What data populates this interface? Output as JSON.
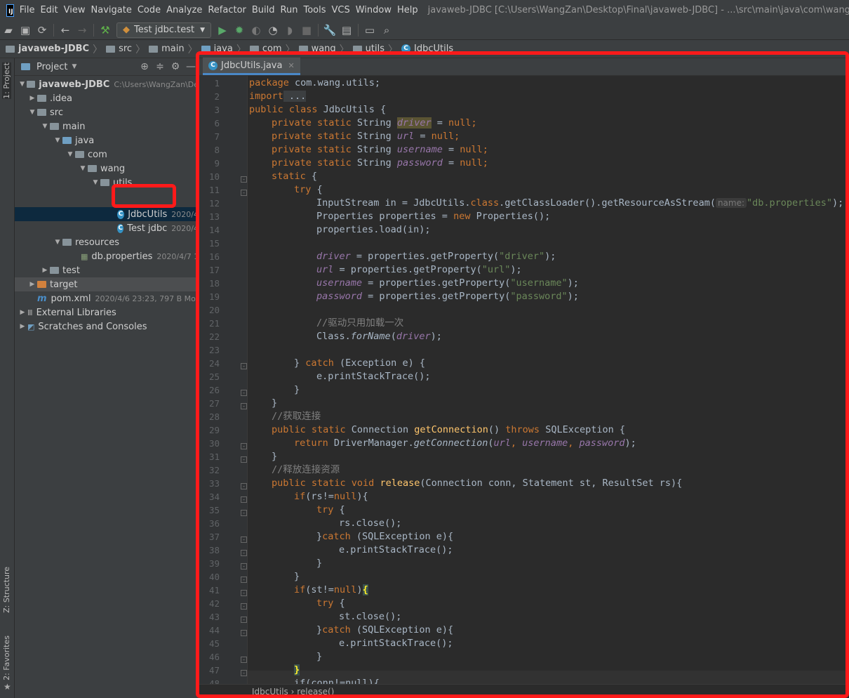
{
  "app": {
    "logo_text": "IJ",
    "window_title": "javaweb-JDBC [C:\\Users\\WangZan\\Desktop\\Final\\javaweb-JDBC] - ...\\src\\main\\java\\com\\wang\\utils\\"
  },
  "menu": [
    "File",
    "Edit",
    "View",
    "Navigate",
    "Code",
    "Analyze",
    "Refactor",
    "Build",
    "Run",
    "Tools",
    "VCS",
    "Window",
    "Help"
  ],
  "toolbar": {
    "run_config": "Test jdbc.test"
  },
  "breadcrumbs": [
    "javaweb-JDBC",
    "src",
    "main",
    "java",
    "com",
    "wang",
    "utils",
    "JdbcUtils"
  ],
  "side_tabs": {
    "project": "1: Project",
    "structure": "Z: Structure",
    "favorites": "2: Favorites"
  },
  "project_panel": {
    "title": "Project"
  },
  "tree": [
    {
      "label": "javaweb-JDBC",
      "meta": "C:\\Users\\WangZan\\De",
      "bold": true
    },
    {
      "label": ".idea",
      "meta": ""
    },
    {
      "label": "src",
      "meta": ""
    },
    {
      "label": "main",
      "meta": ""
    },
    {
      "label": "java",
      "meta": ""
    },
    {
      "label": "com",
      "meta": ""
    },
    {
      "label": "wang",
      "meta": ""
    },
    {
      "label": "utils",
      "meta": ""
    },
    {
      "label": "JdbcUtils",
      "meta": "2020/4"
    },
    {
      "label": "Test jdbc",
      "meta": "2020/4"
    },
    {
      "label": "resources",
      "meta": ""
    },
    {
      "label": "db.properties",
      "meta": "2020/4/7 11"
    },
    {
      "label": "test",
      "meta": ""
    },
    {
      "label": "target",
      "meta": ""
    },
    {
      "label": "pom.xml",
      "meta": "2020/4/6 23:23, 797 B Mom"
    },
    {
      "label": "External Libraries",
      "meta": ""
    },
    {
      "label": "Scratches and Consoles",
      "meta": ""
    }
  ],
  "editor": {
    "tab_label": "JdbcUtils.java",
    "line_numbers": [
      "1",
      "2",
      "3",
      "6",
      "7",
      "8",
      "9",
      "10",
      "11",
      "12",
      "13",
      "14",
      "15",
      "16",
      "17",
      "18",
      "19",
      "20",
      "21",
      "22",
      "23",
      "24",
      "25",
      "26",
      "27",
      "28",
      "29",
      "30",
      "31",
      "32",
      "33",
      "34",
      "35",
      "36",
      "37",
      "38",
      "39",
      "40",
      "41",
      "42",
      "43",
      "44",
      "45",
      "46",
      "47",
      "48"
    ],
    "code": {
      "l1": [
        "package",
        " com.wang.utils;"
      ],
      "l2": [
        "import",
        " ..."
      ],
      "l3": [
        "public class",
        " JdbcUtils {"
      ],
      "l6": [
        "private static",
        " String ",
        "driver",
        " = ",
        "null",
        ";"
      ],
      "l7": [
        "private static",
        " String ",
        "url",
        " = ",
        "null",
        ";"
      ],
      "l8": [
        "private static",
        " String ",
        "username",
        " = ",
        "null",
        ";"
      ],
      "l9": [
        "private static",
        " String ",
        "password",
        " = ",
        "null",
        ";"
      ],
      "l10": [
        "static",
        " {"
      ],
      "l11": [
        "try",
        " {"
      ],
      "l12": [
        "InputStream in = JdbcUtils.",
        "class",
        ".getClassLoader().getResourceAsStream(",
        "name:",
        "\"db.properties\"",
        ");"
      ],
      "l13": [
        "Properties properties = ",
        "new",
        " Properties();"
      ],
      "l14": [
        "properties.load(in);"
      ],
      "l16": [
        "driver",
        " = properties.getProperty(",
        "\"driver\"",
        ");"
      ],
      "l17": [
        "url",
        " = properties.getProperty(",
        "\"url\"",
        ");"
      ],
      "l18": [
        "username",
        " = properties.getProperty(",
        "\"username\"",
        ");"
      ],
      "l19": [
        "password",
        " = properties.getProperty(",
        "\"password\"",
        ");"
      ],
      "l21": [
        "//驱动只用加载一次"
      ],
      "l22": [
        "Class.",
        "forName",
        "(",
        "driver",
        ");"
      ],
      "l24": [
        "} ",
        "catch",
        " (Exception e) {"
      ],
      "l25": [
        "e.printStackTrace();"
      ],
      "l26": [
        "}"
      ],
      "l27": [
        "}"
      ],
      "l28": [
        "//获取连接"
      ],
      "l29": [
        "public static",
        " Connection ",
        "getConnection",
        "() ",
        "throws",
        " SQLException {"
      ],
      "l30": [
        "return",
        " DriverManager.",
        "getConnection",
        "(",
        "url",
        ", ",
        "username",
        ", ",
        "password",
        ");"
      ],
      "l31": [
        "}"
      ],
      "l32": [
        "//释放连接资源"
      ],
      "l33": [
        "public static void",
        " ",
        "release",
        "(Connection conn, Statement st, ResultSet rs){"
      ],
      "l34": [
        "if",
        "(rs!=",
        "null",
        "){"
      ],
      "l35": [
        "try",
        " {"
      ],
      "l36": [
        "rs.close();"
      ],
      "l37": [
        "}",
        "catch",
        " (SQLException e){"
      ],
      "l38": [
        "e.printStackTrace();"
      ],
      "l39": [
        "}"
      ],
      "l40": [
        "}"
      ],
      "l41": [
        "if",
        "(st!=",
        "null",
        ")",
        "{"
      ],
      "l42": [
        "try",
        " {"
      ],
      "l43": [
        "st.close();"
      ],
      "l44": [
        "}",
        "catch",
        " (SQLException e){"
      ],
      "l45": [
        "e.printStackTrace();"
      ],
      "l46": [
        "}"
      ],
      "l47": [
        "}"
      ],
      "l48": [
        "if(conn!=null){"
      ]
    },
    "bottom_breadcrumb": "JdbcUtils  ›  release()"
  }
}
